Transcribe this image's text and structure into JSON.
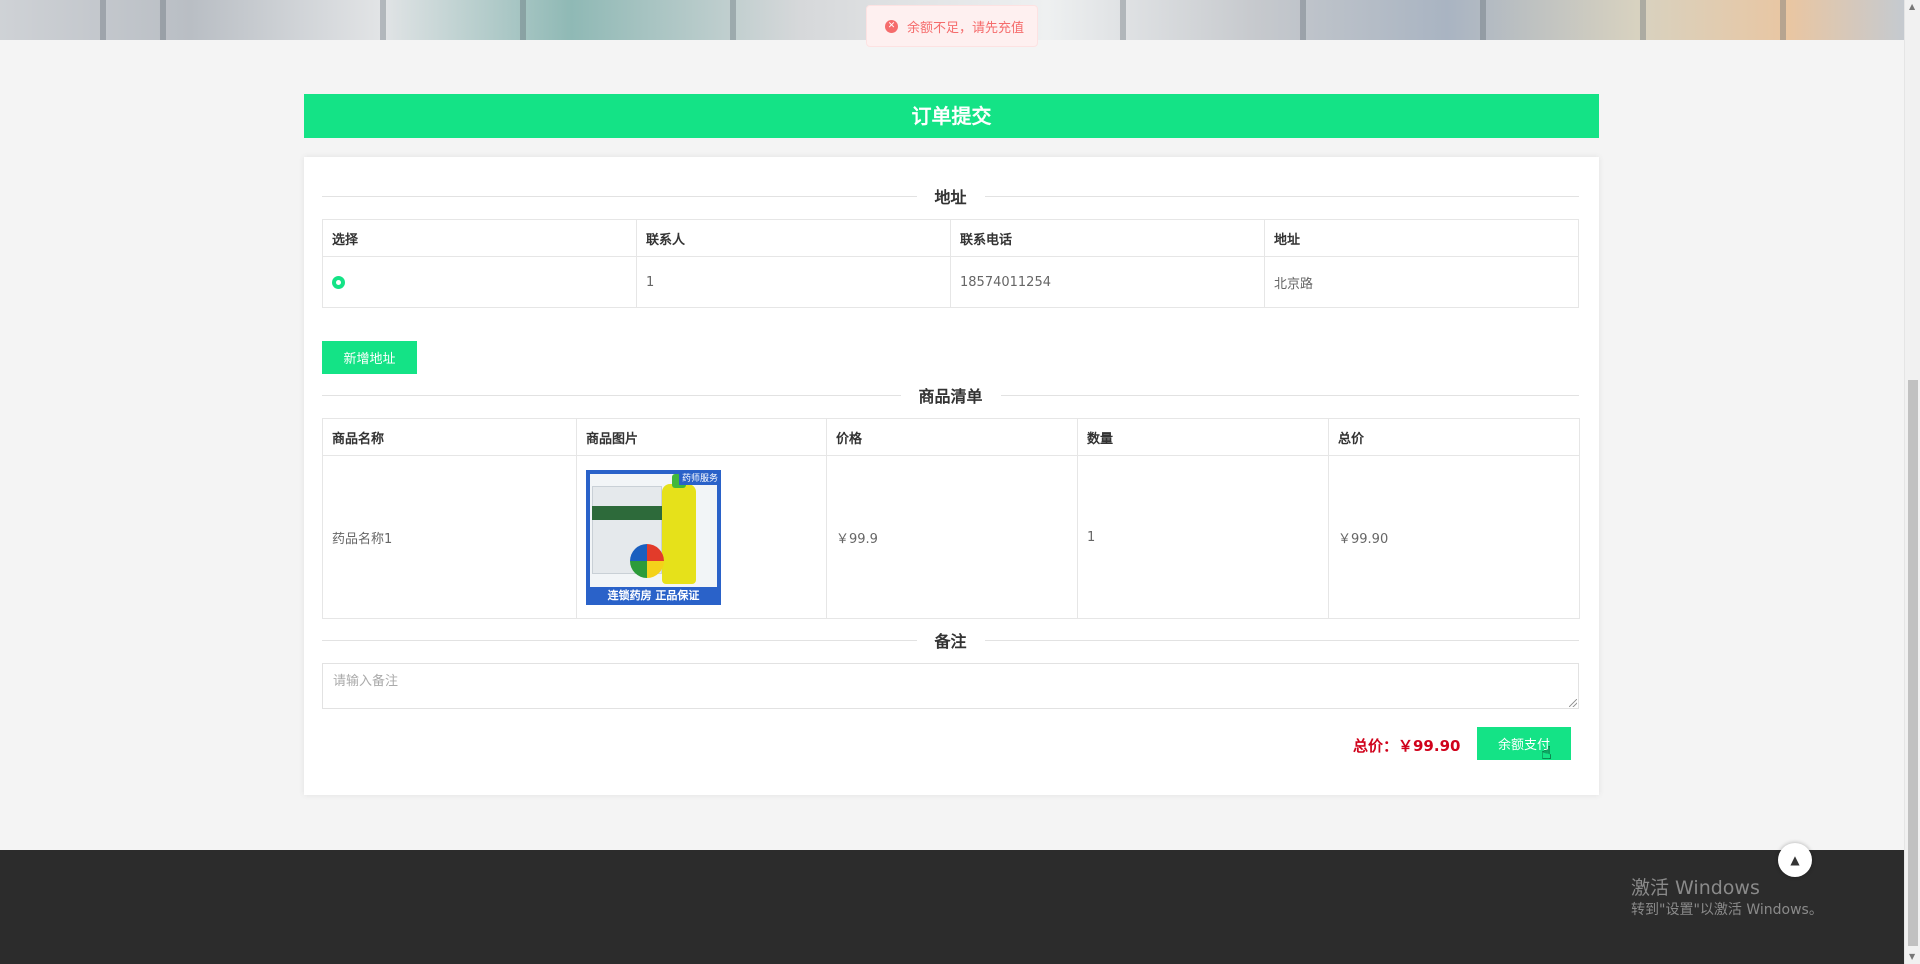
{
  "toast": {
    "icon": "error-icon",
    "message": "余额不足，请先充值"
  },
  "page_title": "订单提交",
  "address_section": {
    "heading": "地址",
    "columns": [
      "选择",
      "联系人",
      "联系电话",
      "地址"
    ],
    "rows": [
      {
        "selected": true,
        "contact": "1",
        "phone": "18574011254",
        "address": "北京路"
      }
    ],
    "add_button": "新增地址"
  },
  "goods_section": {
    "heading": "商品清单",
    "columns": [
      "商品名称",
      "商品图片",
      "价格",
      "数量",
      "总价"
    ],
    "rows": [
      {
        "name": "药品名称1",
        "image": {
          "tag": "药师服务",
          "caption": "连锁药房 正品保证"
        },
        "price": "￥99.9",
        "quantity": "1",
        "total": "￥99.90"
      }
    ]
  },
  "remark_section": {
    "heading": "备注",
    "placeholder": "请输入备注",
    "value": ""
  },
  "summary": {
    "total_label": "总价：￥99.90",
    "pay_button": "余额支付"
  },
  "footer": {
    "watermark_title": "激活 Windows",
    "watermark_sub": "转到\"设置\"以激活 Windows。",
    "back_to_top_icon": "caret-up-icon"
  },
  "colors": {
    "accent": "#14e386",
    "error": "#f56c6c",
    "price": "#d0021b",
    "footer": "#2c2c2c"
  }
}
